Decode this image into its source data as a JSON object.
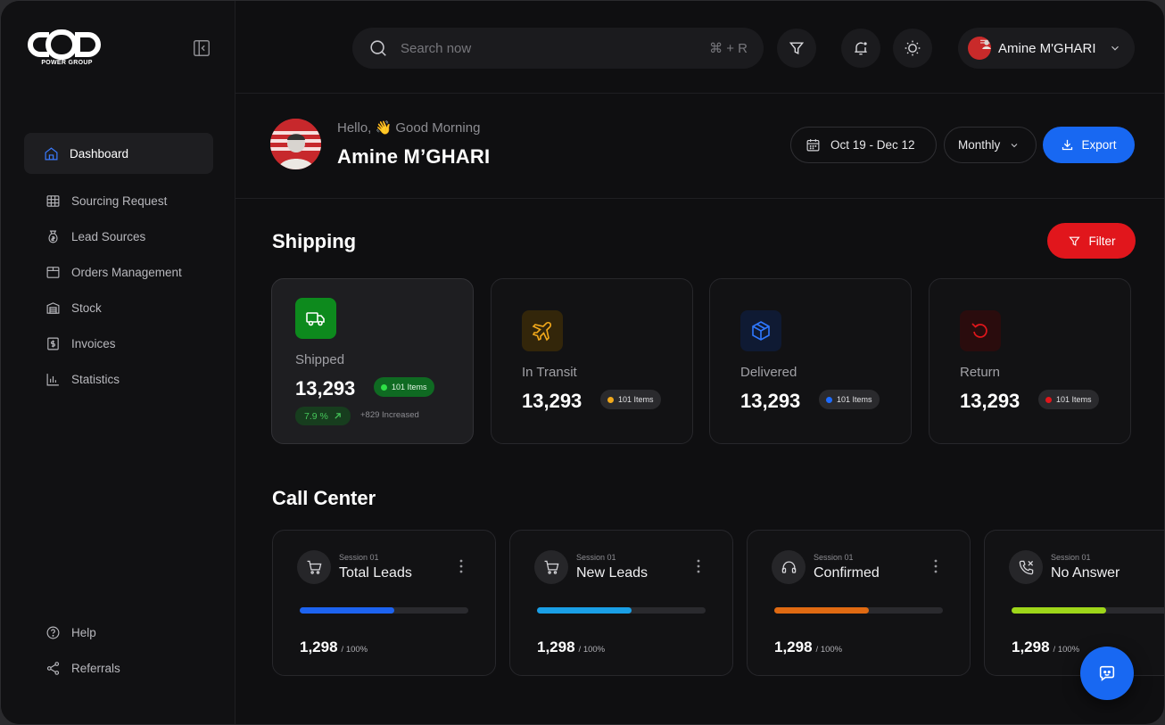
{
  "brand": {
    "sub": "POWER GROUP"
  },
  "nav": {
    "items": [
      {
        "label": "Dashboard",
        "icon": "home-icon",
        "active": true
      },
      {
        "label": "Sourcing Request",
        "icon": "table-icon"
      },
      {
        "label": "Lead Sources",
        "icon": "bag-icon"
      },
      {
        "label": "Orders Management",
        "icon": "box-icon"
      },
      {
        "label": "Stock",
        "icon": "warehouse-icon"
      },
      {
        "label": "Invoices",
        "icon": "invoice-icon"
      },
      {
        "label": "Statistics",
        "icon": "chart-icon"
      }
    ],
    "bottom": [
      {
        "label": "Help",
        "icon": "help-icon"
      },
      {
        "label": "Referrals",
        "icon": "share-icon"
      }
    ]
  },
  "search": {
    "placeholder": "Search now",
    "shortcut": "⌘ + R"
  },
  "user": {
    "name": "Amine M'GHARI"
  },
  "header": {
    "greeting": "Hello, 👋 Good Morning",
    "name": "Amine M’GHARI",
    "date_range": "Oct 19 - Dec 12",
    "period": "Monthly",
    "export_label": "Export"
  },
  "shipping": {
    "title": "Shipping",
    "filter_label": "Filter",
    "cards": [
      {
        "label": "Shipped",
        "value": "13,293",
        "badge": "101 Items",
        "pct": "7.9 %",
        "increase": "+829 Increased",
        "color": "#1fc42f"
      },
      {
        "label": "In Transit",
        "value": "13,293",
        "badge": "101 Items",
        "color": "#f2a91b"
      },
      {
        "label": "Delivered",
        "value": "13,293",
        "badge": "101 Items",
        "color": "#1d6bff"
      },
      {
        "label": "Return",
        "value": "13,293",
        "badge": "101 Items",
        "color": "#e0161b"
      }
    ]
  },
  "call_center": {
    "title": "Call Center",
    "cards": [
      {
        "session": "Session 01",
        "title": "Total Leads",
        "value": "1,298",
        "unit": "/ 100%",
        "progress": 0.56,
        "color": "#1d63f0"
      },
      {
        "session": "Session 01",
        "title": "New Leads",
        "value": "1,298",
        "unit": "/ 100%",
        "progress": 0.56,
        "color": "#1a9fe6"
      },
      {
        "session": "Session 01",
        "title": "Confirmed",
        "value": "1,298",
        "unit": "/ 100%",
        "progress": 0.56,
        "color": "#e06a12"
      },
      {
        "session": "Session 01",
        "title": "No Answer",
        "value": "1,298",
        "unit": "/ 100%",
        "progress": 0.56,
        "color": "#9ed61a"
      }
    ]
  }
}
